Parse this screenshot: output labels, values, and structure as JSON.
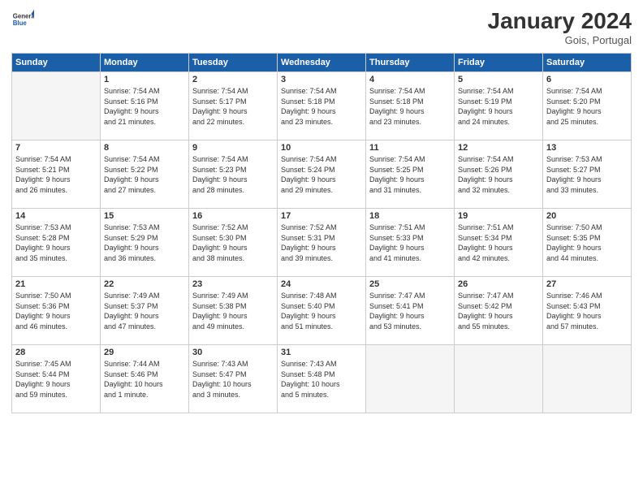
{
  "header": {
    "logo_general": "General",
    "logo_blue": "Blue",
    "month_year": "January 2024",
    "location": "Gois, Portugal"
  },
  "days_of_week": [
    "Sunday",
    "Monday",
    "Tuesday",
    "Wednesday",
    "Thursday",
    "Friday",
    "Saturday"
  ],
  "weeks": [
    [
      {
        "day": "",
        "info": ""
      },
      {
        "day": "1",
        "info": "Sunrise: 7:54 AM\nSunset: 5:16 PM\nDaylight: 9 hours\nand 21 minutes."
      },
      {
        "day": "2",
        "info": "Sunrise: 7:54 AM\nSunset: 5:17 PM\nDaylight: 9 hours\nand 22 minutes."
      },
      {
        "day": "3",
        "info": "Sunrise: 7:54 AM\nSunset: 5:18 PM\nDaylight: 9 hours\nand 23 minutes."
      },
      {
        "day": "4",
        "info": "Sunrise: 7:54 AM\nSunset: 5:18 PM\nDaylight: 9 hours\nand 23 minutes."
      },
      {
        "day": "5",
        "info": "Sunrise: 7:54 AM\nSunset: 5:19 PM\nDaylight: 9 hours\nand 24 minutes."
      },
      {
        "day": "6",
        "info": "Sunrise: 7:54 AM\nSunset: 5:20 PM\nDaylight: 9 hours\nand 25 minutes."
      }
    ],
    [
      {
        "day": "7",
        "info": "Sunrise: 7:54 AM\nSunset: 5:21 PM\nDaylight: 9 hours\nand 26 minutes."
      },
      {
        "day": "8",
        "info": "Sunrise: 7:54 AM\nSunset: 5:22 PM\nDaylight: 9 hours\nand 27 minutes."
      },
      {
        "day": "9",
        "info": "Sunrise: 7:54 AM\nSunset: 5:23 PM\nDaylight: 9 hours\nand 28 minutes."
      },
      {
        "day": "10",
        "info": "Sunrise: 7:54 AM\nSunset: 5:24 PM\nDaylight: 9 hours\nand 29 minutes."
      },
      {
        "day": "11",
        "info": "Sunrise: 7:54 AM\nSunset: 5:25 PM\nDaylight: 9 hours\nand 31 minutes."
      },
      {
        "day": "12",
        "info": "Sunrise: 7:54 AM\nSunset: 5:26 PM\nDaylight: 9 hours\nand 32 minutes."
      },
      {
        "day": "13",
        "info": "Sunrise: 7:53 AM\nSunset: 5:27 PM\nDaylight: 9 hours\nand 33 minutes."
      }
    ],
    [
      {
        "day": "14",
        "info": "Sunrise: 7:53 AM\nSunset: 5:28 PM\nDaylight: 9 hours\nand 35 minutes."
      },
      {
        "day": "15",
        "info": "Sunrise: 7:53 AM\nSunset: 5:29 PM\nDaylight: 9 hours\nand 36 minutes."
      },
      {
        "day": "16",
        "info": "Sunrise: 7:52 AM\nSunset: 5:30 PM\nDaylight: 9 hours\nand 38 minutes."
      },
      {
        "day": "17",
        "info": "Sunrise: 7:52 AM\nSunset: 5:31 PM\nDaylight: 9 hours\nand 39 minutes."
      },
      {
        "day": "18",
        "info": "Sunrise: 7:51 AM\nSunset: 5:33 PM\nDaylight: 9 hours\nand 41 minutes."
      },
      {
        "day": "19",
        "info": "Sunrise: 7:51 AM\nSunset: 5:34 PM\nDaylight: 9 hours\nand 42 minutes."
      },
      {
        "day": "20",
        "info": "Sunrise: 7:50 AM\nSunset: 5:35 PM\nDaylight: 9 hours\nand 44 minutes."
      }
    ],
    [
      {
        "day": "21",
        "info": "Sunrise: 7:50 AM\nSunset: 5:36 PM\nDaylight: 9 hours\nand 46 minutes."
      },
      {
        "day": "22",
        "info": "Sunrise: 7:49 AM\nSunset: 5:37 PM\nDaylight: 9 hours\nand 47 minutes."
      },
      {
        "day": "23",
        "info": "Sunrise: 7:49 AM\nSunset: 5:38 PM\nDaylight: 9 hours\nand 49 minutes."
      },
      {
        "day": "24",
        "info": "Sunrise: 7:48 AM\nSunset: 5:40 PM\nDaylight: 9 hours\nand 51 minutes."
      },
      {
        "day": "25",
        "info": "Sunrise: 7:47 AM\nSunset: 5:41 PM\nDaylight: 9 hours\nand 53 minutes."
      },
      {
        "day": "26",
        "info": "Sunrise: 7:47 AM\nSunset: 5:42 PM\nDaylight: 9 hours\nand 55 minutes."
      },
      {
        "day": "27",
        "info": "Sunrise: 7:46 AM\nSunset: 5:43 PM\nDaylight: 9 hours\nand 57 minutes."
      }
    ],
    [
      {
        "day": "28",
        "info": "Sunrise: 7:45 AM\nSunset: 5:44 PM\nDaylight: 9 hours\nand 59 minutes."
      },
      {
        "day": "29",
        "info": "Sunrise: 7:44 AM\nSunset: 5:46 PM\nDaylight: 10 hours\nand 1 minute."
      },
      {
        "day": "30",
        "info": "Sunrise: 7:43 AM\nSunset: 5:47 PM\nDaylight: 10 hours\nand 3 minutes."
      },
      {
        "day": "31",
        "info": "Sunrise: 7:43 AM\nSunset: 5:48 PM\nDaylight: 10 hours\nand 5 minutes."
      },
      {
        "day": "",
        "info": ""
      },
      {
        "day": "",
        "info": ""
      },
      {
        "day": "",
        "info": ""
      }
    ]
  ]
}
